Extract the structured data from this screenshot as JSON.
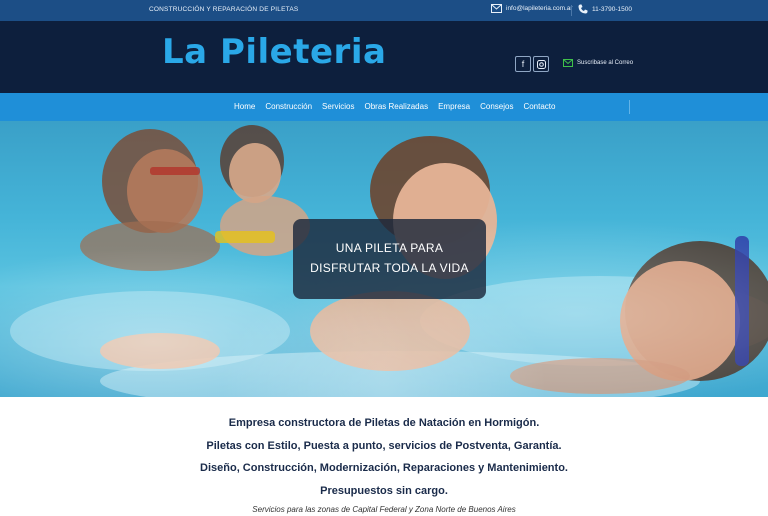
{
  "topbar": {
    "tagline": "CONSTRUCCIÓN Y REPARACIÓN DE PILETAS",
    "email": "info@lapileteria.com.ar",
    "phone": "11-3790-1500"
  },
  "header": {
    "logo_text": "La Pileteria",
    "subscribe_label": "Suscribase al Correo"
  },
  "nav": {
    "items": [
      "Home",
      "Construcción",
      "Servicios",
      "Obras Realizadas",
      "Empresa",
      "Consejos",
      "Contacto"
    ]
  },
  "hero": {
    "line1": "UNA PILETA PARA",
    "line2": "DISFRUTAR TODA LA VIDA"
  },
  "content": {
    "p1": "Empresa constructora de Piletas de Natación en Hormigón.",
    "p2": "Piletas con Estilo, Puesta a punto, servicios de Postventa, Garantía.",
    "p3": "Diseño, Construcción, Modernización, Reparaciones y Mantenimiento.",
    "p4": "Presupuestos sin cargo.",
    "note": "Servicios para las zonas de Capital Federal y Zona Norte de Buenos Aires"
  },
  "colors": {
    "topbar": "#1c4e86",
    "header": "#0d1f3d",
    "nav": "#1f8fd8",
    "logo": "#2aa8e8",
    "text": "#1a2b4a"
  }
}
